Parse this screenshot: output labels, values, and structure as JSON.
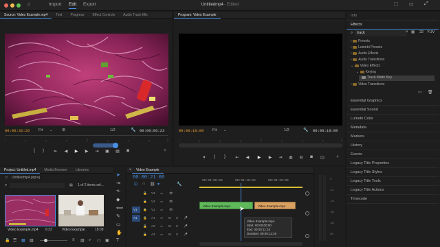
{
  "menu": {
    "import": "Import",
    "edit": "Edit",
    "export": "Export"
  },
  "doc": {
    "title": "Untitledmp4",
    "edited": " - Edited"
  },
  "source": {
    "tabs": [
      "Source: Video Example.mp4",
      "Text",
      "Progress",
      "Effect Controls",
      "Audio Track Mix"
    ],
    "timecode": "00:00:32:26",
    "fit": "Fit",
    "page": "1/2",
    "duration": "00:00:06:23"
  },
  "program": {
    "tab": "Program: Video Example",
    "timecode": "00:00:18:09",
    "fit": "Fit",
    "page": "1/2",
    "duration": "00:00:18:09"
  },
  "project": {
    "tabs": [
      "Project: Untitled.mp4",
      "Media Browser",
      "Libraries"
    ],
    "file": "Untitledmp4.prproj",
    "selected": "1 of 2 items sel...",
    "items": [
      {
        "name": "Video Example.mp4",
        "dur": "6:23"
      },
      {
        "name": "Video Example",
        "dur": "18:09"
      }
    ]
  },
  "timeline": {
    "tab": "Video Example",
    "timecode": "00:00:21:00",
    "ruler": [
      "00:00:05:00",
      "00:00:10:00",
      "00:00:15:00"
    ],
    "tracks": [
      {
        "label": "V3"
      },
      {
        "label": "V2"
      },
      {
        "label": "V1"
      },
      {
        "label": "A1"
      },
      {
        "label": "A2"
      },
      {
        "label": "A3"
      }
    ],
    "clips": [
      "Video Example.mp4",
      "Video Example.mp4"
    ],
    "tooltip": {
      "name": "Video Example.mp4",
      "start": "Start: 00:00:00:00",
      "end": "End: 00:00:11:15",
      "duration": "Duration: 00:00:11:16"
    },
    "audio_ticks": [
      "0",
      "-12",
      "-24",
      "-36",
      "-48",
      "dB"
    ]
  },
  "right": {
    "info": "Info",
    "effects": "Effects",
    "search": "track",
    "tree": [
      "Presets",
      "Lumetri Presets",
      "Audio Effects",
      "Audio Transitions",
      "Video Effects",
      "Keying",
      "Track Matte Key",
      "Video Transitions"
    ],
    "panels": [
      "Essential Graphics",
      "Essential Sound",
      "Lumetri Color",
      "Metadata",
      "Markers",
      "History",
      "Events",
      "Legacy Title Properties",
      "Legacy Title Styles",
      "Legacy Title Tools",
      "Legacy Title Actions",
      "Timecode"
    ]
  },
  "colors": {
    "accent": "#4a90e2",
    "timecode": "#f0a030",
    "clip_green": "#5fb85a",
    "clip_orange": "#d9a060"
  }
}
